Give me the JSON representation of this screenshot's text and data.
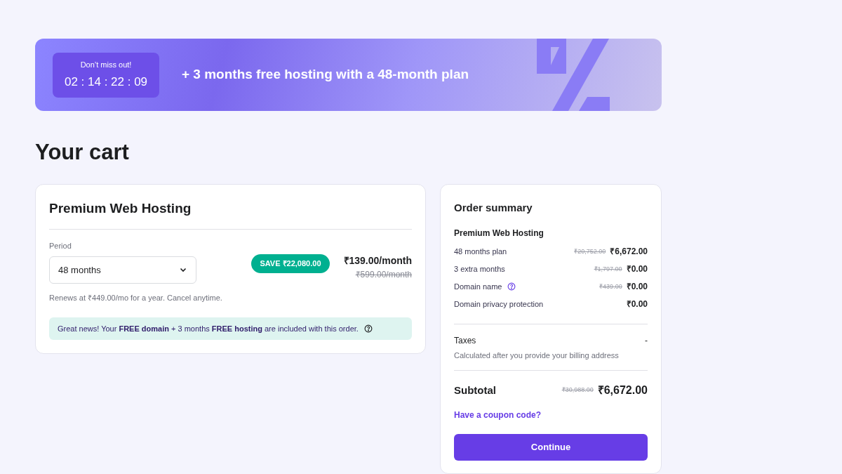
{
  "banner": {
    "label": "Don’t miss out!",
    "countdown": "02 : 14 : 22 : 09",
    "headline": "+ 3 months free hosting with a 48-month plan"
  },
  "title": "Your cart",
  "cart_item": {
    "title": "Premium Web Hosting",
    "period_label": "Period",
    "period_value": "48 months",
    "save_badge": "SAVE ₹22,080.00",
    "price": "₹139.00/month",
    "old_price": "₹599.00/month",
    "renews_note": "Renews at ₹449.00/mo for a year. Cancel anytime.",
    "info_note": "Great news! Your **FREE domain** + 3 months **FREE hosting** are included with this order."
  },
  "summary": {
    "title": "Order summary",
    "product": "Premium Web Hosting",
    "lines": [
      {
        "label": "48 months plan",
        "old_price": "₹20,752.00",
        "price": "₹6,672.00",
        "help": false
      },
      {
        "label": "3 extra months",
        "old_price": "₹1,797.00",
        "price": "₹0.00",
        "help": false
      },
      {
        "label": "Domain name",
        "old_price": "₹439.00",
        "price": "₹0.00",
        "help": true
      },
      {
        "label": "Domain privacy protection",
        "price": "₹0.00",
        "help": false
      }
    ],
    "taxes": {
      "label": "Taxes",
      "value": "-",
      "note": "Calculated after you provide your billing address"
    },
    "subtotal": {
      "label": "Subtotal",
      "old_price": "₹30,988.00",
      "price": "₹6,672.00"
    },
    "coupon_link": "Have a coupon code?",
    "continue_button": "Continue"
  }
}
